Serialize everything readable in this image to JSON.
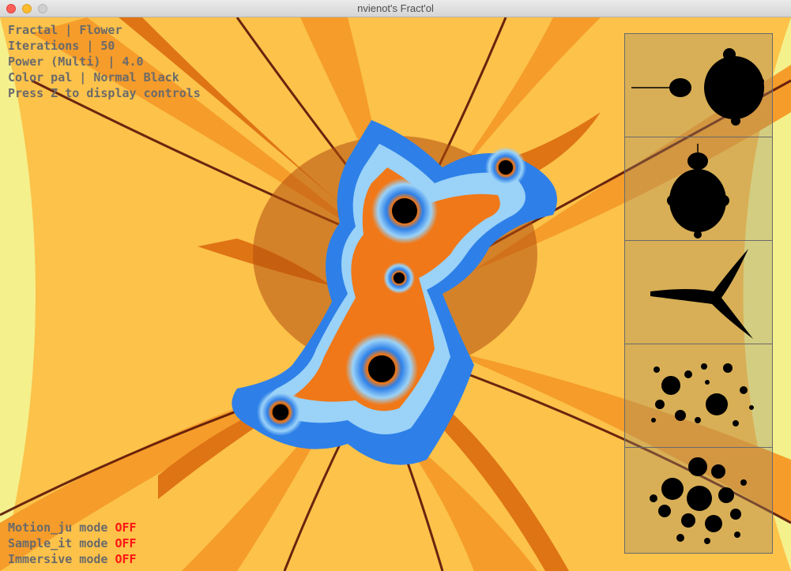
{
  "window": {
    "title": "nvienot's Fract'ol"
  },
  "hud": {
    "fractal_label": "Fractal",
    "fractal_value": "Flower",
    "iterations_label": "Iterations",
    "iterations_value": "50",
    "power_label": "Power (Multi)",
    "power_value": "4.0",
    "color_label": "Color pal",
    "color_value": "Normal Black",
    "hint": "Press Z to display controls",
    "separator": " | "
  },
  "modes": [
    {
      "label": "Motion_ju mode",
      "state": "OFF"
    },
    {
      "label": "Sample_it mode",
      "state": "OFF"
    },
    {
      "label": "Immersive mode",
      "state": "OFF"
    }
  ],
  "thumbnails": [
    {
      "name": "mandelbrot-horizontal"
    },
    {
      "name": "mandelbrot-vertical"
    },
    {
      "name": "tricorn"
    },
    {
      "name": "julia-dust-1"
    },
    {
      "name": "julia-dust-2"
    }
  ],
  "colors": {
    "bg_outer": "#f4f08c",
    "band_1": "#fcc24a",
    "band_2": "#f59c2a",
    "band_3": "#df7414",
    "band_4": "#b24e0e",
    "vein": "#5a1408",
    "fractal_core": "#000000",
    "blue": "#2e80e8",
    "light_blue": "#9ad2f8",
    "hud_text": "#6a6a6a",
    "off_text": "#ff1414"
  }
}
